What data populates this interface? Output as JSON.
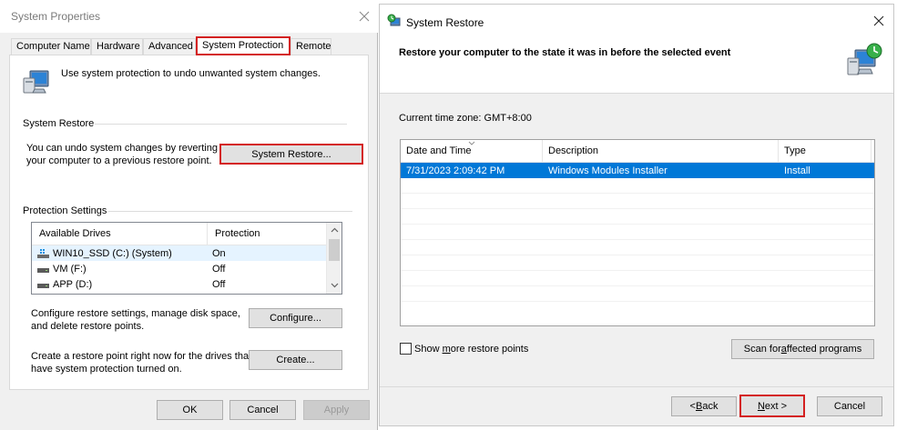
{
  "system_properties": {
    "title": "System Properties",
    "tabs": [
      "Computer Name",
      "Hardware",
      "Advanced",
      "System Protection",
      "Remote"
    ],
    "intro_text": "Use system protection to undo unwanted system changes.",
    "system_restore_group": {
      "title": "System Restore",
      "description_line1": "You can undo system changes by reverting",
      "description_line2": "your computer to a previous restore point.",
      "button": "System Restore..."
    },
    "protection_group": {
      "title": "Protection Settings",
      "columns": [
        "Available Drives",
        "Protection"
      ],
      "drives": [
        {
          "name": "WIN10_SSD (C:) (System)",
          "protection": "On"
        },
        {
          "name": "VM (F:)",
          "protection": "Off"
        },
        {
          "name": "APP (D:)",
          "protection": "Off"
        }
      ],
      "configure_text_line1": "Configure restore settings, manage disk space,",
      "configure_text_line2": "and delete restore points.",
      "configure_button": "Configure...",
      "create_text_line1": "Create a restore point right now for the drives that",
      "create_text_line2": "have system protection turned on.",
      "create_button": "Create..."
    },
    "buttons": {
      "ok": "OK",
      "cancel": "Cancel",
      "apply": "Apply"
    }
  },
  "system_restore": {
    "title": "System Restore",
    "heading": "Restore your computer to the state it was in before the selected event",
    "timezone": "Current time zone: GMT+8:00",
    "columns": [
      "Date and Time",
      "Description",
      "Type"
    ],
    "rows": [
      {
        "date": "7/31/2023 2:09:42 PM",
        "description": "Windows Modules Installer",
        "type": "Install"
      }
    ],
    "show_more": {
      "pre": "Show ",
      "accel": "m",
      "post": "ore restore points"
    },
    "scan": {
      "pre": "Scan for ",
      "accel": "a",
      "post": "ffected programs"
    },
    "back": {
      "pre": "< ",
      "accel": "B",
      "post": "ack"
    },
    "next": {
      "accel": "N",
      "post": "ext >"
    },
    "cancel": "Cancel"
  },
  "colors": {
    "highlight": "#d42020",
    "selection": "#0078d7"
  },
  "icons": [
    "close-icon",
    "computer-restore-icon",
    "drive-icon",
    "sort-arrow-icon"
  ]
}
